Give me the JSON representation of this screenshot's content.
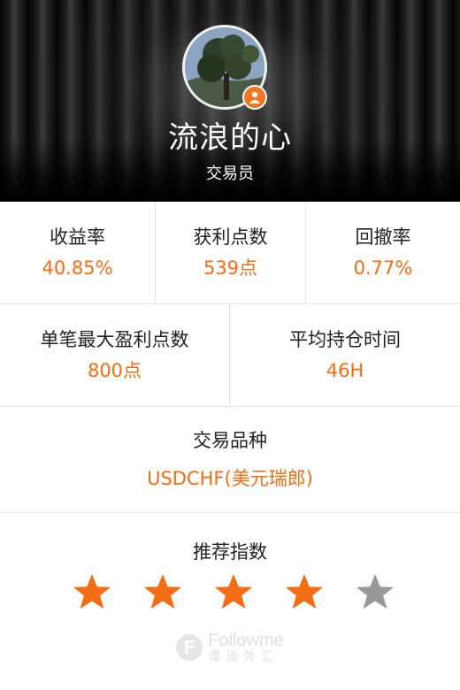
{
  "profile": {
    "name": "流浪的心",
    "role": "交易员",
    "avatar": "avatar-tree-photo",
    "badge_icon": "user-icon"
  },
  "stats_row1": [
    {
      "label": "收益率",
      "value": "40.85%"
    },
    {
      "label": "获利点数",
      "value": "539点"
    },
    {
      "label": "回撤率",
      "value": "0.77%"
    }
  ],
  "stats_row2": [
    {
      "label": "单笔最大盈利点数",
      "value": "800点"
    },
    {
      "label": "平均持仓时间",
      "value": "46H"
    }
  ],
  "product": {
    "label": "交易品种",
    "value": "USDCHF(美元瑞郎)"
  },
  "recommendation": {
    "label": "推荐指数",
    "rating": 4,
    "max": 5
  },
  "logo": {
    "en": "Followme",
    "cn": "谭谈外汇",
    "mark": "F"
  },
  "colors": {
    "accent": "#f26d16",
    "badge": "#f37521",
    "star_on": "#f26d16",
    "star_off": "#999999"
  }
}
